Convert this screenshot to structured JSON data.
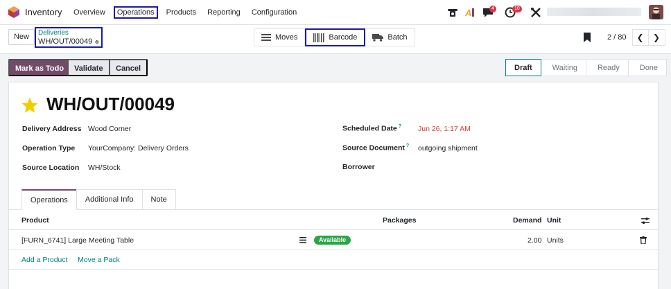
{
  "app": {
    "name": "Inventory",
    "colors": {
      "brand": "#714b67",
      "accent": "#017e84",
      "danger": "#d23f3a",
      "success": "#28a745",
      "highlight": "#1a1aa6"
    }
  },
  "menu": {
    "items": [
      {
        "label": "Overview"
      },
      {
        "label": "Operations"
      },
      {
        "label": "Products"
      },
      {
        "label": "Reporting"
      },
      {
        "label": "Configuration"
      }
    ]
  },
  "systray": {
    "phone_icon": "phone-icon",
    "ai_icon": "ai-icon",
    "messages_badge": "4",
    "activities_badge": "10",
    "tools_icon": "tools-icon"
  },
  "control": {
    "new_label": "New",
    "breadcrumb_parent": "Deliveries",
    "breadcrumb_current": "WH/OUT/00049",
    "views": [
      {
        "label": "Moves"
      },
      {
        "label": "Barcode"
      },
      {
        "label": "Batch"
      }
    ],
    "pager_value": "2 / 80"
  },
  "statusbar": {
    "mark_todo": "Mark as Todo",
    "validate": "Validate",
    "cancel": "Cancel",
    "stages": [
      "Draft",
      "Waiting",
      "Ready",
      "Done"
    ]
  },
  "record": {
    "title": "WH/OUT/00049",
    "fields": {
      "delivery_address_label": "Delivery Address",
      "delivery_address": "Wood Corner",
      "operation_type_label": "Operation Type",
      "operation_type": "YourCompany: Delivery Orders",
      "source_location_label": "Source Location",
      "source_location": "WH/Stock",
      "scheduled_date_label": "Scheduled Date",
      "scheduled_date": "Jun 26, 1:17 AM",
      "source_document_label": "Source Document",
      "source_document": "outgoing shipment",
      "borrower_label": "Borrower",
      "help_mark": "?"
    }
  },
  "tabs": [
    "Operations",
    "Additional Info",
    "Note"
  ],
  "operations_table": {
    "headers": {
      "product": "Product",
      "packages": "Packages",
      "demand": "Demand",
      "unit": "Unit"
    },
    "rows": [
      {
        "product": "[FURN_6741] Large Meeting Table",
        "status": "Available",
        "demand": "2.00",
        "unit": "Units"
      }
    ],
    "add_product": "Add a Product",
    "move_pack": "Move a Pack"
  }
}
